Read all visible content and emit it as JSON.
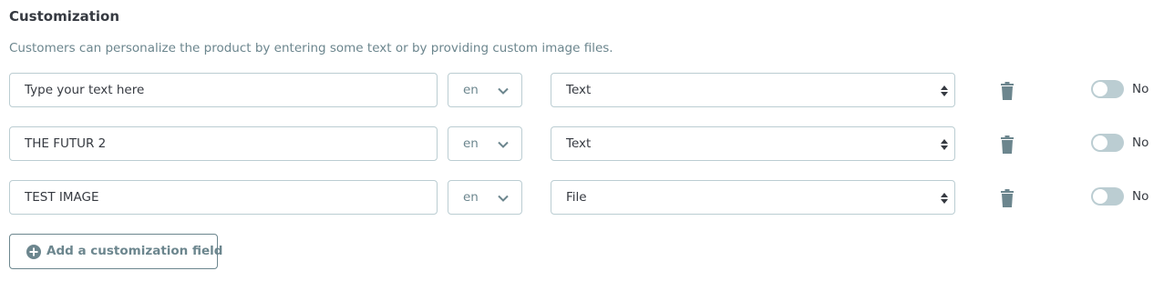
{
  "section": {
    "title": "Customization",
    "help": "Customers can personalize the product by entering some text or by providing custom image files."
  },
  "fields": [
    {
      "label_value": "",
      "label_placeholder": "Type your text here",
      "language": "en",
      "type": "Text",
      "required_label": "No",
      "required": false,
      "delete_icon": "trash-icon"
    },
    {
      "label_value": "THE FUTUR 2",
      "label_placeholder": "",
      "language": "en",
      "type": "Text",
      "required_label": "No",
      "required": false,
      "delete_icon": "trash-icon"
    },
    {
      "label_value": "TEST IMAGE",
      "label_placeholder": "",
      "language": "en",
      "type": "File",
      "required_label": "No",
      "required": false,
      "delete_icon": "trash-icon"
    }
  ],
  "add_button": {
    "label": "Add a customization field",
    "icon": "plus-circle-icon"
  },
  "colors": {
    "border": "#bbcdd2",
    "muted_text": "#6c868e",
    "text": "#363a41",
    "toggle_off": "#bbcdd2"
  }
}
